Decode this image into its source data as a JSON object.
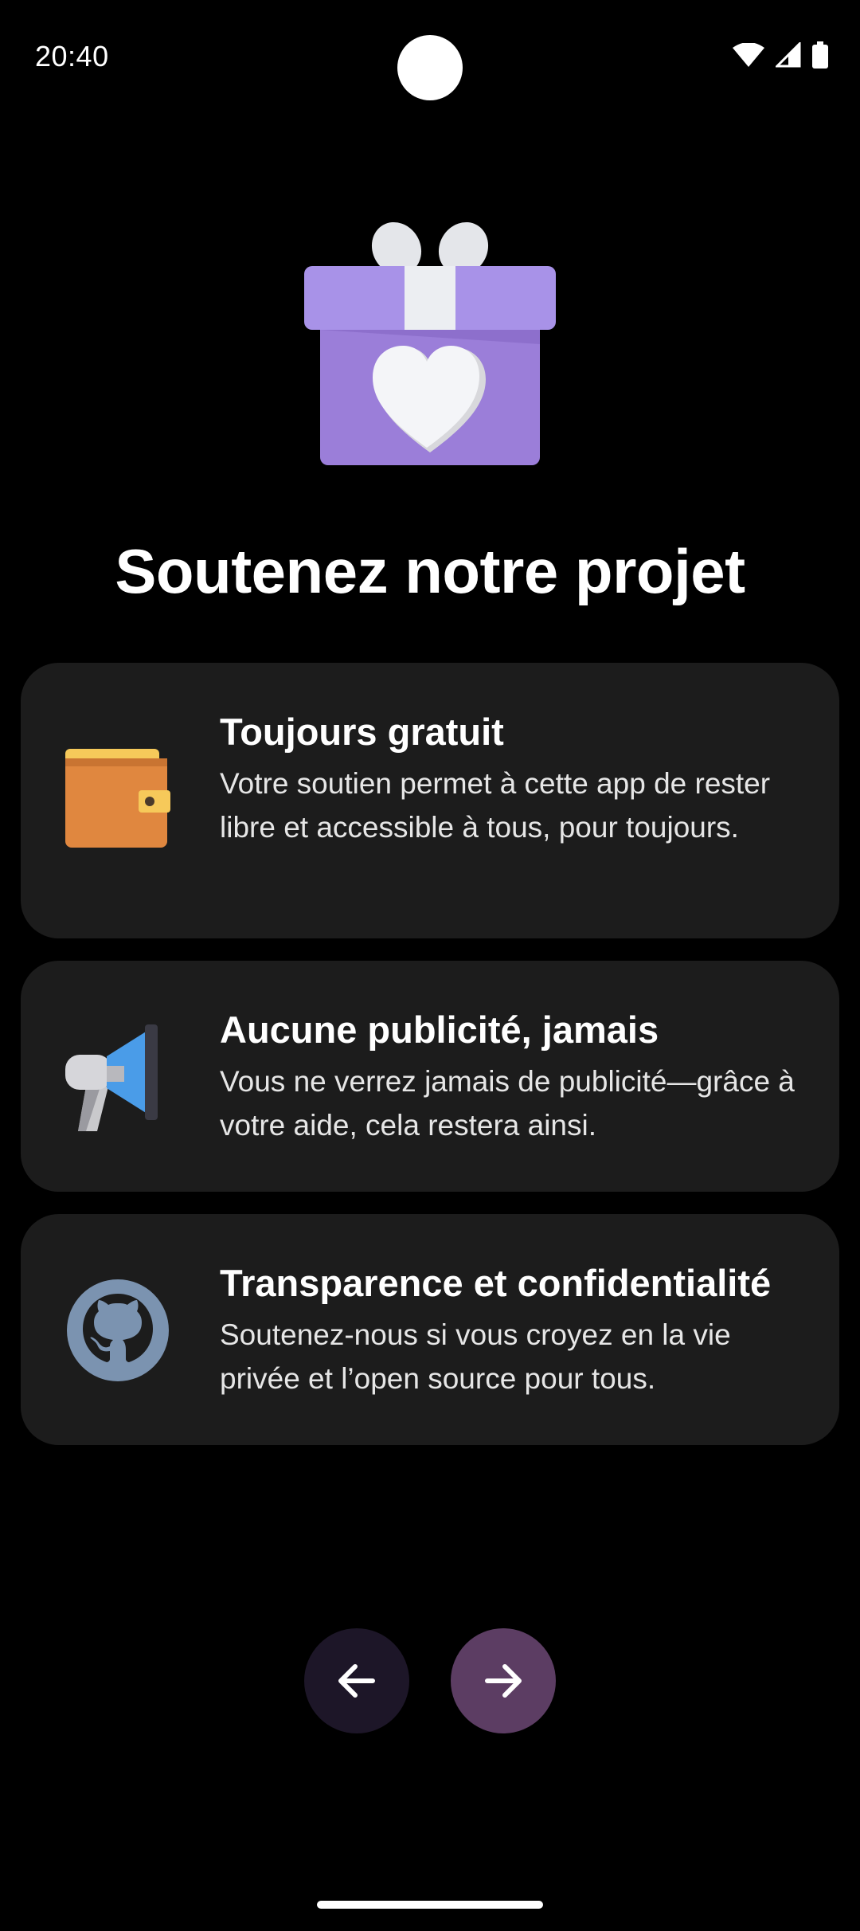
{
  "status_bar": {
    "time": "20:40",
    "icons": [
      "wifi-icon",
      "signal-icon",
      "battery-icon"
    ]
  },
  "hero": {
    "icon": "gift-heart-icon"
  },
  "title": "Soutenez notre projet",
  "cards": [
    {
      "icon": "wallet-icon",
      "title": "Toujours gratuit",
      "description": "Votre soutien permet à cette app de rester libre et accessible à tous, pour toujours."
    },
    {
      "icon": "megaphone-icon",
      "title": "Aucune publicité, jamais",
      "description": "Vous ne verrez jamais de publicité—grâce à votre aide, cela restera ainsi."
    },
    {
      "icon": "github-icon",
      "title": "Transparence et confidentialité",
      "description": "Soutenez-nous si vous croyez en la vie privée et l’open source pour tous."
    }
  ],
  "navigation": {
    "prev_icon": "arrow-left-icon",
    "next_icon": "arrow-right-icon"
  },
  "colors": {
    "background": "#000000",
    "card": "#1c1c1c",
    "prev_button": "#1d1628",
    "next_button": "#5c3d63",
    "gift": "#a68ee8"
  }
}
